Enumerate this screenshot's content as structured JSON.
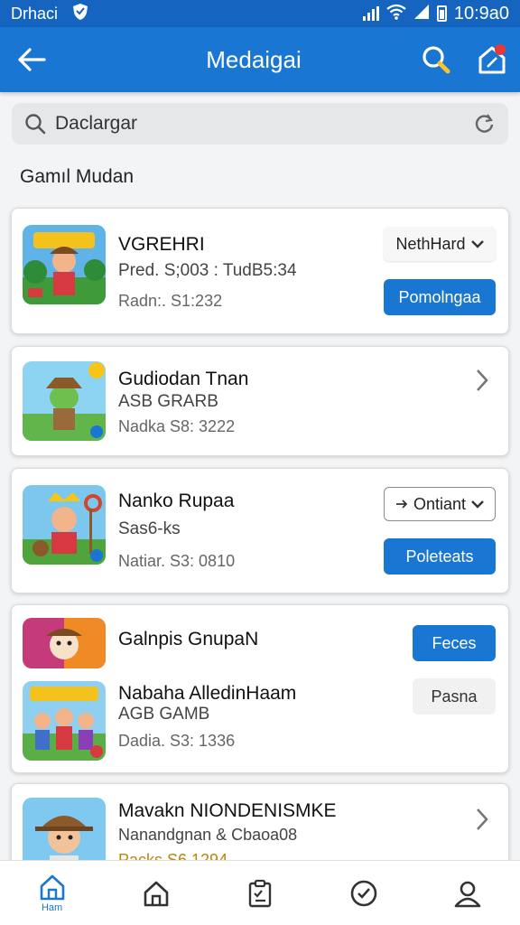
{
  "colors": {
    "primary": "#1976d2",
    "status_bar": "#1565c0",
    "background": "#f3f4f6"
  },
  "status_bar": {
    "carrier": "Drhaci",
    "time": "10:9a0"
  },
  "app_bar": {
    "title": "Medaigai",
    "icons": [
      "back-arrow-icon",
      "search-icon",
      "notification-icon"
    ]
  },
  "search": {
    "placeholder": "Daclargar"
  },
  "section": {
    "title": "Gamıl Mudan"
  },
  "games": [
    {
      "name": "VGREHRI",
      "line2": "Pred.  S;003  :  TudB5:34",
      "line3": "Radn:. S1:232",
      "dropdown": "NethHard",
      "button": "Pomolngaa"
    },
    {
      "name": "Gudiodan Tnan",
      "line2": "ASB GRARB",
      "line3": "Nadka  S8: 3222"
    },
    {
      "name": "Nanko Rupaa",
      "line2": "Sas6-ks",
      "line3": "Natiar. S3: 0810",
      "dropdown": "Ontiant",
      "button": "Poleteats"
    },
    {
      "name": "Galnpis GnupaN",
      "button": "Feces"
    },
    {
      "name": "Nabaha AlledinHaam",
      "line2": "AGB GAMB",
      "line3": "Dadia. S3: 1336",
      "button": "Pasna"
    },
    {
      "name": "Mavakn NIONDENISMKE",
      "line2": "Nanandgnan & Cbaoa08",
      "line3": "Packs  S6  1294"
    }
  ],
  "bottom_nav": {
    "active_label": "Ham",
    "items": [
      "home-icon",
      "house-icon",
      "clipboard-icon",
      "check-circle-icon",
      "profile-icon"
    ]
  }
}
